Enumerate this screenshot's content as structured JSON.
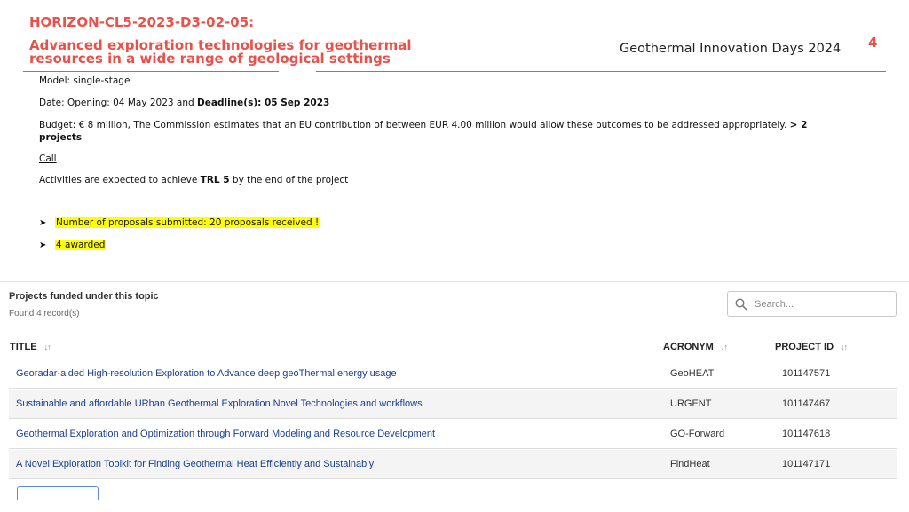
{
  "slide": {
    "topic_code": "HORIZON-CL5-2023-D3-02-05:",
    "topic_title": "Advanced exploration technologies for geothermal resources in a wide range of geological settings",
    "event": "Geothermal Innovation Days 2024",
    "page_number": "4"
  },
  "info": {
    "model": "Model: single-stage",
    "date_prefix": "Date: Opening: 04 May 2023 and ",
    "date_bold": "Deadline(s): 05 Sep 2023",
    "budget_text": "Budget: € 8 million, The Commission estimates that an EU contribution of between EUR 4.00 million would allow these outcomes to be addressed appropriately. ",
    "budget_bold_1": "> 2",
    "budget_bold_2": "projects",
    "call_link": "Call",
    "trl_prefix": "Activities are expected to achieve ",
    "trl_bold": "TRL 5",
    "trl_suffix": " by the end of the project"
  },
  "bullets": [
    {
      "icon": "arrow-bullet-icon",
      "text": "Number of proposals submitted: 20 proposals received !"
    },
    {
      "icon": "arrow-bullet-icon",
      "text": "4 awarded"
    }
  ],
  "portal": {
    "heading": "Projects funded under this topic",
    "record_count": "Found 4 record(s)",
    "search_placeholder": "Search...",
    "columns": [
      "TITLE",
      "ACRONYM",
      "PROJECT ID"
    ],
    "sort_icon": "sort-arrows-icon",
    "rows": [
      {
        "title": "Georadar-aided High-resolution Exploration to Advance deep geoThermal energy usage",
        "acronym": "GeoHEAT",
        "project_id": "101147571"
      },
      {
        "title": "Sustainable and affordable URban Geothermal Exploration Novel Technologies and workflows",
        "acronym": "URGENT",
        "project_id": "101147467"
      },
      {
        "title": "Geothermal Exploration and Optimization through Forward Modeling and Resource Development",
        "acronym": "GO-Forward",
        "project_id": "101147618"
      },
      {
        "title": "A Novel Exploration Toolkit for Finding Geothermal Heat Efficiently and Sustainably",
        "acronym": "FindHeat",
        "project_id": "101147171"
      }
    ]
  },
  "colors": {
    "accent": "#e8524a",
    "highlight": "#ffff00",
    "link": "#1a3f8f"
  }
}
